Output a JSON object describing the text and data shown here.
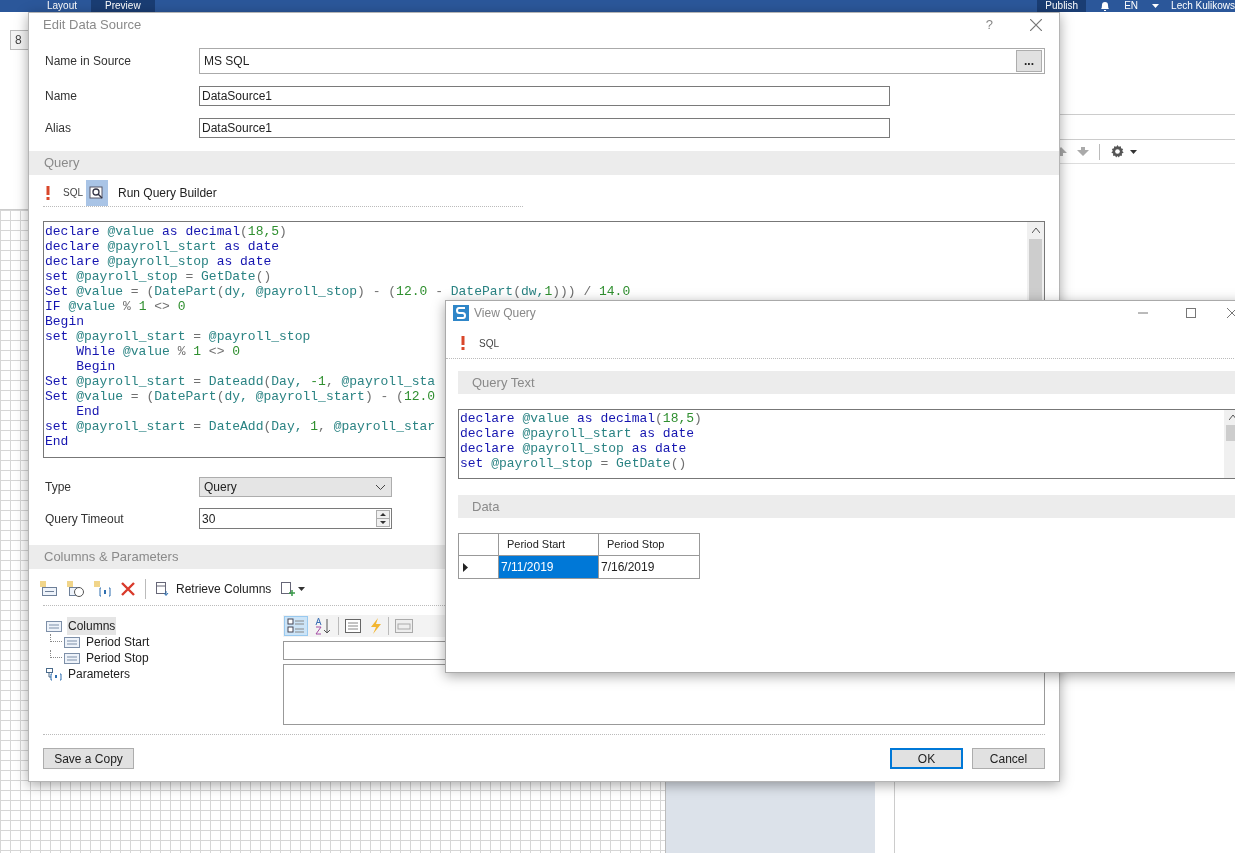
{
  "app": {
    "tabs": [
      {
        "label": "Layout",
        "selected": false
      },
      {
        "label": "Preview",
        "selected": true
      }
    ],
    "publish": "Publish",
    "language": "EN",
    "user": "Lech Kulikows",
    "font_size": "8"
  },
  "edit_dialog": {
    "title": "Edit Data Source",
    "help": "?",
    "fields": [
      {
        "label": "Name in Source",
        "value": "MS SQL",
        "browse": "..."
      },
      {
        "label": "Name",
        "value": "DataSource1"
      },
      {
        "label": "Alias",
        "value": "DataSource1"
      }
    ],
    "query_section": "Query",
    "query_mode": "SQL",
    "query_builder": "Run Query Builder",
    "code": [
      [
        {
          "text": "declare ",
          "kind": "kw"
        },
        {
          "text": "@value ",
          "kind": "var"
        },
        {
          "text": "as decimal",
          "kind": "kw"
        },
        {
          "text": "(",
          "kind": "op"
        },
        {
          "text": "18,5",
          "kind": "num"
        },
        {
          "text": ")",
          "kind": "op"
        }
      ],
      [
        {
          "text": "declare ",
          "kind": "kw"
        },
        {
          "text": "@payroll_start ",
          "kind": "var"
        },
        {
          "text": "as date",
          "kind": "kw"
        }
      ],
      [
        {
          "text": "declare ",
          "kind": "kw"
        },
        {
          "text": "@payroll_stop ",
          "kind": "var"
        },
        {
          "text": "as date",
          "kind": "kw"
        }
      ],
      [
        {
          "text": "set ",
          "kind": "kw"
        },
        {
          "text": "@payroll_stop ",
          "kind": "var"
        },
        {
          "text": "= ",
          "kind": "op"
        },
        {
          "text": "GetDate",
          "kind": "var"
        },
        {
          "text": "()",
          "kind": "op"
        }
      ],
      [
        {
          "text": "Set ",
          "kind": "kw"
        },
        {
          "text": "@value ",
          "kind": "var"
        },
        {
          "text": "= (",
          "kind": "op"
        },
        {
          "text": "DatePart",
          "kind": "var"
        },
        {
          "text": "(",
          "kind": "op"
        },
        {
          "text": "dy, @payroll_stop",
          "kind": "var"
        },
        {
          "text": ") - (",
          "kind": "op"
        },
        {
          "text": "12.0",
          "kind": "num"
        },
        {
          "text": " - ",
          "kind": "op"
        },
        {
          "text": "DatePart",
          "kind": "var"
        },
        {
          "text": "(",
          "kind": "op"
        },
        {
          "text": "dw,",
          "kind": "var"
        },
        {
          "text": "1",
          "kind": "num"
        },
        {
          "text": "))) / ",
          "kind": "op"
        },
        {
          "text": "14.0",
          "kind": "num"
        }
      ],
      [
        {
          "text": "IF ",
          "kind": "kw"
        },
        {
          "text": "@value ",
          "kind": "var"
        },
        {
          "text": "% ",
          "kind": "op"
        },
        {
          "text": "1 ",
          "kind": "num"
        },
        {
          "text": "<> ",
          "kind": "op"
        },
        {
          "text": "0",
          "kind": "num"
        }
      ],
      [
        {
          "text": "Begin",
          "kind": "kw"
        }
      ],
      [
        {
          "text": "set ",
          "kind": "kw"
        },
        {
          "text": "@payroll_start ",
          "kind": "var"
        },
        {
          "text": "= ",
          "kind": "op"
        },
        {
          "text": "@payroll_stop",
          "kind": "var"
        }
      ],
      [
        {
          "text": "    While ",
          "kind": "kw"
        },
        {
          "text": "@value ",
          "kind": "var"
        },
        {
          "text": "% ",
          "kind": "op"
        },
        {
          "text": "1 ",
          "kind": "num"
        },
        {
          "text": "<> ",
          "kind": "op"
        },
        {
          "text": "0",
          "kind": "num"
        }
      ],
      [
        {
          "text": "    Begin",
          "kind": "kw"
        }
      ],
      [
        {
          "text": "Set ",
          "kind": "kw"
        },
        {
          "text": "@payroll_start ",
          "kind": "var"
        },
        {
          "text": "= ",
          "kind": "op"
        },
        {
          "text": "Dateadd",
          "kind": "var"
        },
        {
          "text": "(",
          "kind": "op"
        },
        {
          "text": "Day, ",
          "kind": "var"
        },
        {
          "text": "-1",
          "kind": "num"
        },
        {
          "text": ", ",
          "kind": "op"
        },
        {
          "text": "@payroll_sta",
          "kind": "var"
        }
      ],
      [
        {
          "text": "Set ",
          "kind": "kw"
        },
        {
          "text": "@value ",
          "kind": "var"
        },
        {
          "text": "= (",
          "kind": "op"
        },
        {
          "text": "DatePart",
          "kind": "var"
        },
        {
          "text": "(",
          "kind": "op"
        },
        {
          "text": "dy, @payroll_start",
          "kind": "var"
        },
        {
          "text": ") - (",
          "kind": "op"
        },
        {
          "text": "12.0",
          "kind": "num"
        }
      ],
      [
        {
          "text": "    End",
          "kind": "kw"
        }
      ],
      [
        {
          "text": "set ",
          "kind": "kw"
        },
        {
          "text": "@payroll_start ",
          "kind": "var"
        },
        {
          "text": "= ",
          "kind": "op"
        },
        {
          "text": "DateAdd",
          "kind": "var"
        },
        {
          "text": "(",
          "kind": "op"
        },
        {
          "text": "Day, ",
          "kind": "var"
        },
        {
          "text": "1",
          "kind": "num"
        },
        {
          "text": ", ",
          "kind": "op"
        },
        {
          "text": "@payroll_star",
          "kind": "var"
        }
      ],
      [
        {
          "text": "End",
          "kind": "kw"
        }
      ]
    ],
    "type": {
      "label": "Type",
      "value": "Query"
    },
    "timeout": {
      "label": "Query Timeout",
      "value": "30"
    },
    "columns_section": "Columns & Parameters",
    "retrieve": "Retrieve Columns",
    "tree": [
      {
        "label": "Columns",
        "kind": "columns",
        "selected": true,
        "children": [
          {
            "label": "Period Start",
            "kind": "column",
            "selected": false
          },
          {
            "label": "Period Stop",
            "kind": "column",
            "selected": false
          }
        ]
      },
      {
        "label": "Parameters",
        "kind": "parameters",
        "selected": false
      }
    ],
    "property_views": [
      {
        "kind": "categorized",
        "selected": true
      },
      {
        "kind": "alphabetical",
        "selected": false
      },
      {
        "kind": "properties",
        "selected": false
      },
      {
        "kind": "events",
        "selected": false
      },
      {
        "kind": "pages",
        "selected": false
      }
    ],
    "save_copy": "Save a Copy",
    "ok": "OK",
    "cancel": "Cancel"
  },
  "view_query": {
    "title": "View Query",
    "query_mode": "SQL",
    "text_section": "Query Text",
    "code": [
      [
        {
          "text": "declare ",
          "kind": "kw"
        },
        {
          "text": "@value ",
          "kind": "var"
        },
        {
          "text": "as decimal",
          "kind": "kw"
        },
        {
          "text": "(",
          "kind": "op"
        },
        {
          "text": "18,5",
          "kind": "num"
        },
        {
          "text": ")",
          "kind": "op"
        }
      ],
      [
        {
          "text": "declare ",
          "kind": "kw"
        },
        {
          "text": "@payroll_start ",
          "kind": "var"
        },
        {
          "text": "as date",
          "kind": "kw"
        }
      ],
      [
        {
          "text": "declare ",
          "kind": "kw"
        },
        {
          "text": "@payroll_stop ",
          "kind": "var"
        },
        {
          "text": "as date",
          "kind": "kw"
        }
      ],
      [
        {
          "text": "set ",
          "kind": "kw"
        },
        {
          "text": "@payroll_stop ",
          "kind": "var"
        },
        {
          "text": "= ",
          "kind": "op"
        },
        {
          "text": "GetDate",
          "kind": "var"
        },
        {
          "text": "()",
          "kind": "op"
        }
      ]
    ],
    "data_section": "Data",
    "columns": [
      "Period Start",
      "Period Stop"
    ],
    "rows": [
      {
        "current": true,
        "cells": [
          {
            "text": "7/11/2019",
            "selected": true
          },
          {
            "text": "7/16/2019",
            "selected": false
          }
        ]
      }
    ]
  }
}
